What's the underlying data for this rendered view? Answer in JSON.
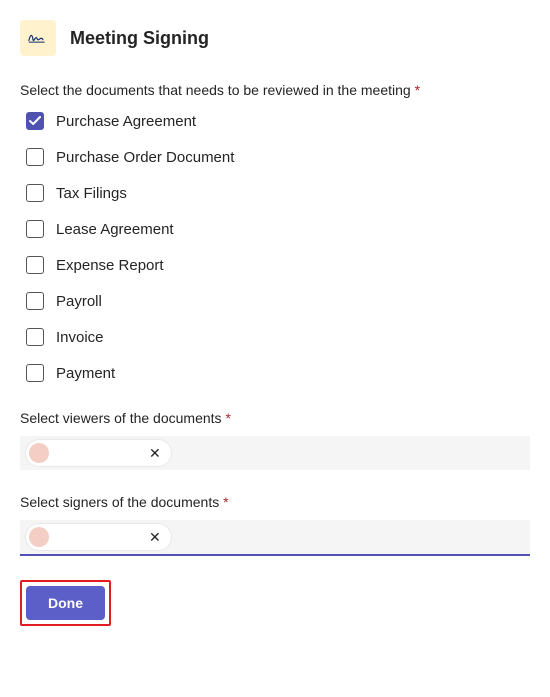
{
  "header": {
    "title": "Meeting Signing"
  },
  "documents": {
    "prompt": "Select the documents that needs to be reviewed in the meeting",
    "items": [
      {
        "label": "Purchase Agreement",
        "checked": true
      },
      {
        "label": "Purchase Order Document",
        "checked": false
      },
      {
        "label": "Tax Filings",
        "checked": false
      },
      {
        "label": "Lease Agreement",
        "checked": false
      },
      {
        "label": "Expense Report",
        "checked": false
      },
      {
        "label": "Payroll",
        "checked": false
      },
      {
        "label": "Invoice",
        "checked": false
      },
      {
        "label": "Payment",
        "checked": false
      }
    ]
  },
  "viewers": {
    "label": "Select viewers of the documents",
    "chips": [
      {
        "name": ""
      }
    ]
  },
  "signers": {
    "label": "Select signers of the documents",
    "chips": [
      {
        "name": ""
      }
    ],
    "active": true
  },
  "actions": {
    "done": "Done"
  },
  "required_marker": "*"
}
